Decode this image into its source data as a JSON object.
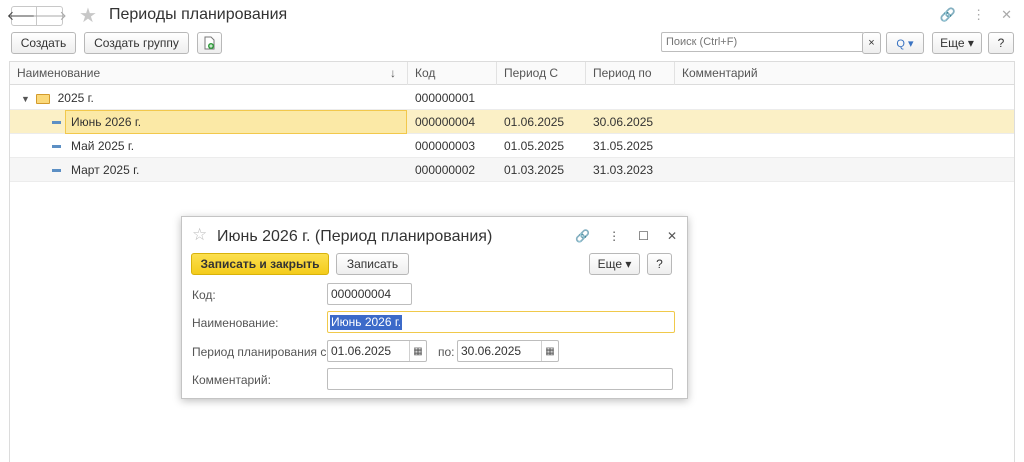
{
  "window": {
    "title": "Периоды планирования",
    "nav_back": "🡐",
    "nav_forward": "🡒",
    "icons": [
      "link-icon",
      "more-icon",
      "close-icon"
    ]
  },
  "toolbar": {
    "create": "Создать",
    "create_group": "Создать группу",
    "search_placeholder": "Поиск (Ctrl+F)",
    "search_clear": "×",
    "search_btn": "Q ▾",
    "more": "Еще ▾",
    "help": "?"
  },
  "table": {
    "columns": [
      "Наименование",
      "Код",
      "Период С",
      "Период по",
      "Комментарий"
    ],
    "sort_indicator": "↓",
    "rows": [
      {
        "name": "2025 г.",
        "code": "000000001",
        "from": "",
        "to": "",
        "comment": "",
        "type": "group"
      },
      {
        "name": "Июнь 2026 г.",
        "code": "000000004",
        "from": "01.06.2025",
        "to": "30.06.2025",
        "comment": "",
        "type": "item"
      },
      {
        "name": "Май 2025 г.",
        "code": "000000003",
        "from": "01.05.2025",
        "to": "31.05.2025",
        "comment": "",
        "type": "item"
      },
      {
        "name": "Март 2025 г.",
        "code": "000000002",
        "from": "01.03.2025",
        "to": "31.03.2023",
        "comment": "",
        "type": "item"
      }
    ]
  },
  "dialog": {
    "title": "Июнь 2026 г. (Период планирования)",
    "save_close": "Записать и закрыть",
    "save": "Записать",
    "more": "Еще ▾",
    "help": "?",
    "code_label": "Код:",
    "code_value": "000000004",
    "name_label": "Наименование:",
    "name_value": "Июнь 2026 г.",
    "period_label": "Период планирования с:",
    "period_from": "01.06.2025",
    "period_to_label": "по:",
    "period_to": "30.06.2025",
    "comment_label": "Комментарий:",
    "comment_value": ""
  },
  "colors": {
    "selected_row": "#fbf0c6",
    "primary_button": "#f4cc1b",
    "selection_highlight": "#3c6ac9"
  }
}
